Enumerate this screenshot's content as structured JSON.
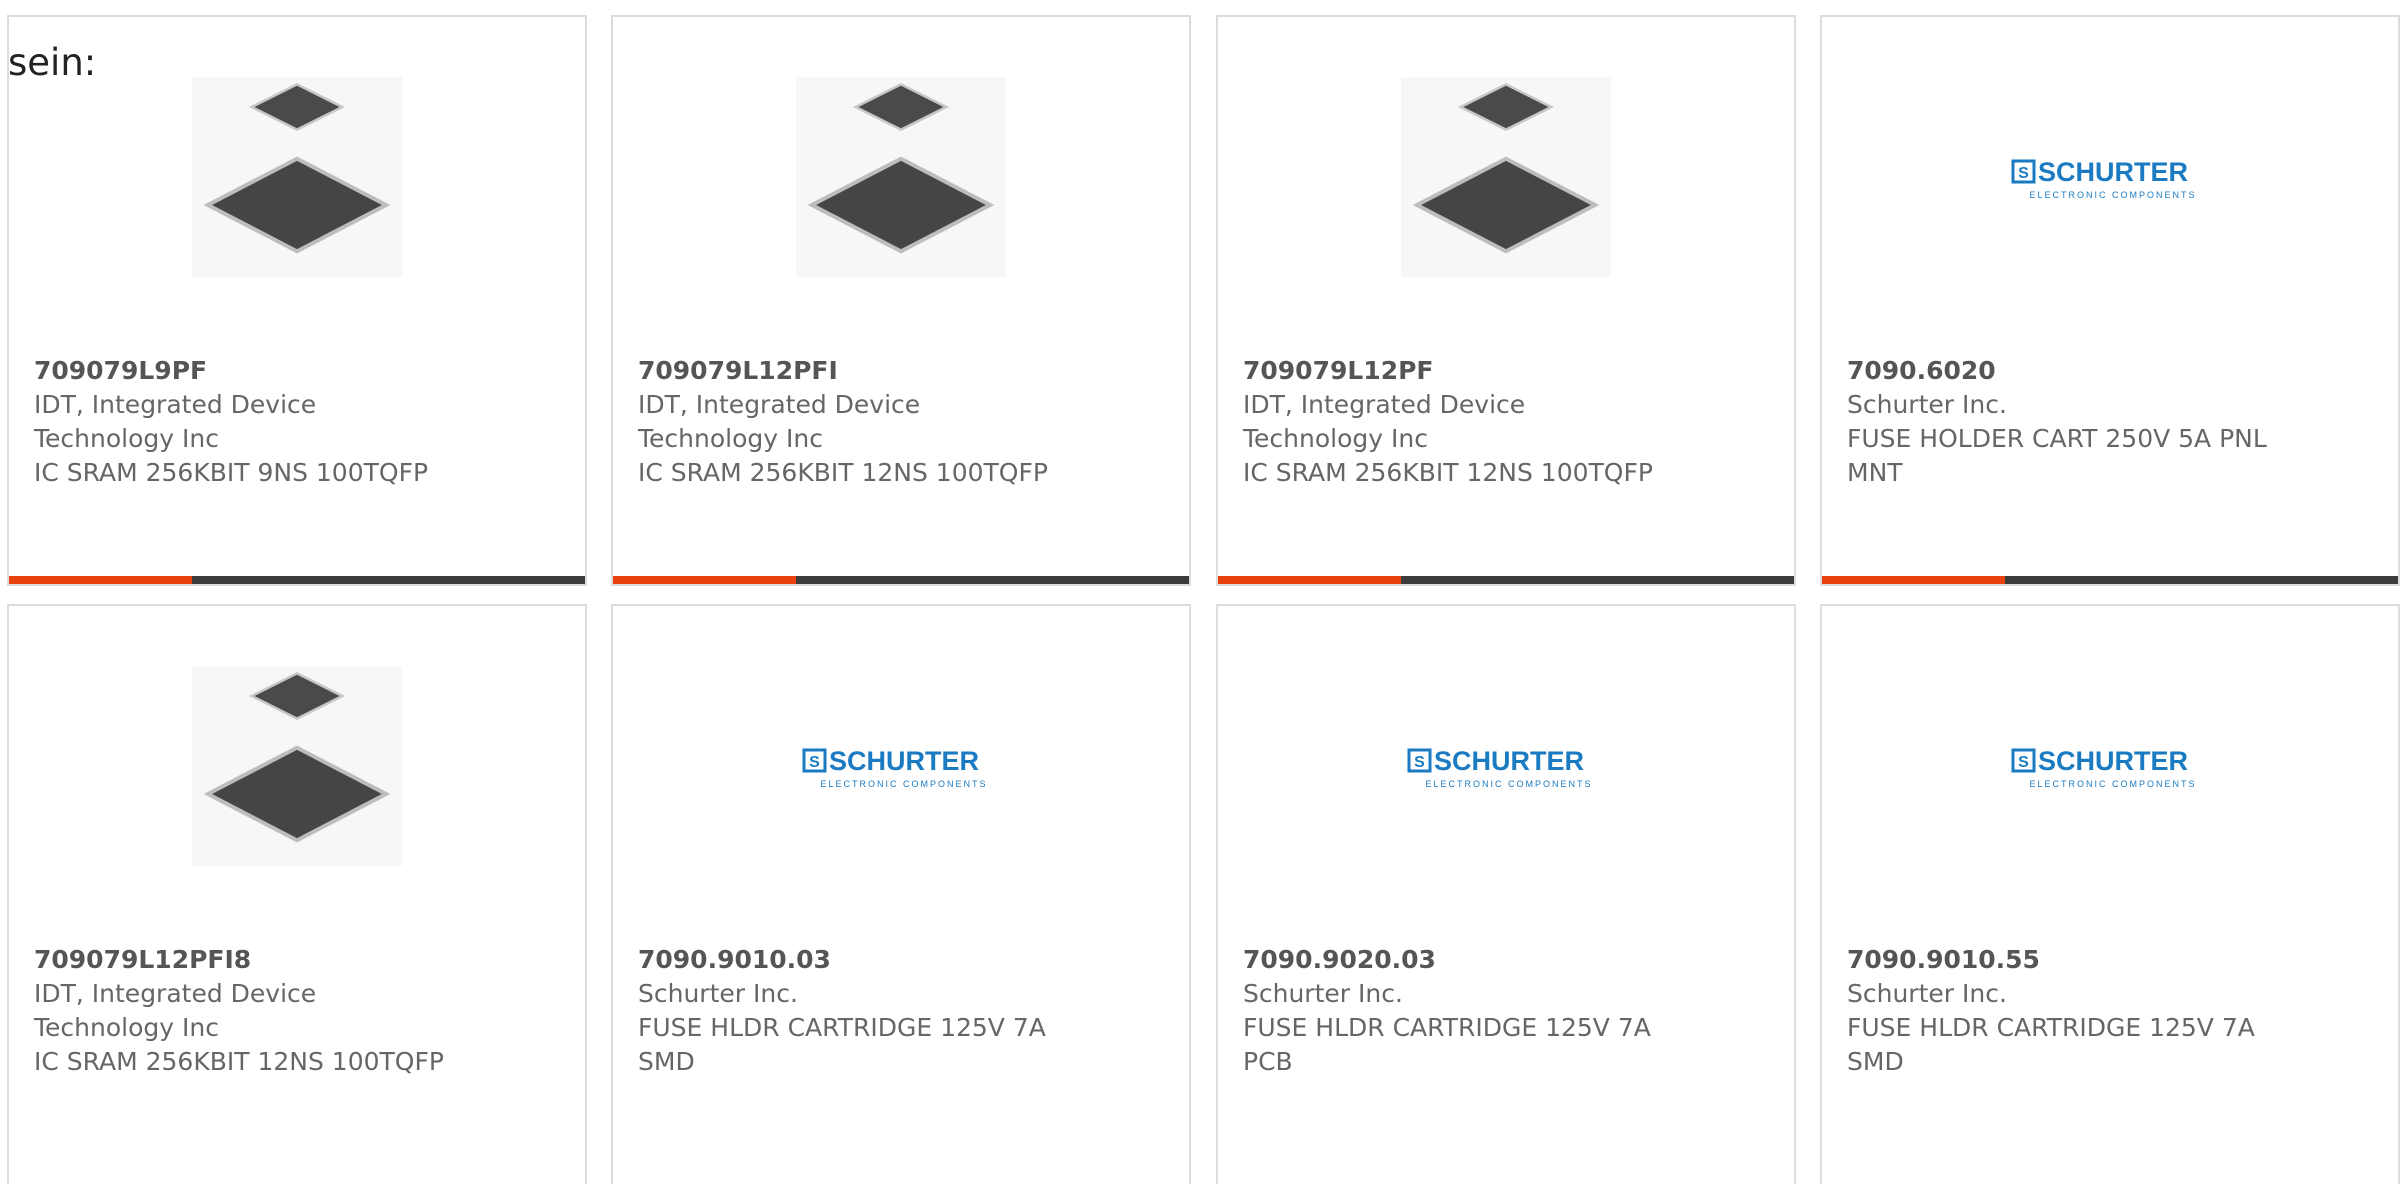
{
  "intro_text": "sein:",
  "colors": {
    "accent": "#e8410f",
    "bar": "#3c3c3c",
    "schurter_blue": "#1a7bc2"
  },
  "products": [
    {
      "part_number": "709079L9PF",
      "manufacturer_line1": "IDT, Integrated Device",
      "manufacturer_line2": "Technology Inc",
      "description_line1": "IC SRAM 256KBIT 9NS 100TQFP",
      "description_line2": "",
      "image": "ic-chip-image"
    },
    {
      "part_number": "709079L12PFI",
      "manufacturer_line1": "IDT, Integrated Device",
      "manufacturer_line2": "Technology Inc",
      "description_line1": "IC SRAM 256KBIT 12NS 100TQFP",
      "description_line2": "",
      "image": "ic-chip-image"
    },
    {
      "part_number": "709079L12PF",
      "manufacturer_line1": "IDT, Integrated Device",
      "manufacturer_line2": "Technology Inc",
      "description_line1": "IC SRAM 256KBIT 12NS 100TQFP",
      "description_line2": "",
      "image": "ic-chip-image"
    },
    {
      "part_number": "7090.6020",
      "manufacturer_line1": "Schurter Inc.",
      "manufacturer_line2": "",
      "description_line1": "FUSE HOLDER CART 250V 5A PNL",
      "description_line2": "MNT",
      "image": "schurter-logo"
    },
    {
      "part_number": "709079L12PFI8",
      "manufacturer_line1": "IDT, Integrated Device",
      "manufacturer_line2": "Technology Inc",
      "description_line1": "IC SRAM 256KBIT 12NS 100TQFP",
      "description_line2": "",
      "image": "ic-chip-image"
    },
    {
      "part_number": "7090.9010.03",
      "manufacturer_line1": "Schurter Inc.",
      "manufacturer_line2": "",
      "description_line1": "FUSE HLDR CARTRIDGE 125V 7A",
      "description_line2": "SMD",
      "image": "schurter-logo"
    },
    {
      "part_number": "7090.9020.03",
      "manufacturer_line1": "Schurter Inc.",
      "manufacturer_line2": "",
      "description_line1": "FUSE HLDR CARTRIDGE 125V 7A",
      "description_line2": "PCB",
      "image": "schurter-logo"
    },
    {
      "part_number": "7090.9010.55",
      "manufacturer_line1": "Schurter Inc.",
      "manufacturer_line2": "",
      "description_line1": "FUSE HLDR CARTRIDGE 125V 7A",
      "description_line2": "SMD",
      "image": "schurter-logo"
    }
  ],
  "schurter_logo": {
    "wordmark": "SCHURTER",
    "tagline": "ELECTRONIC COMPONENTS",
    "badge_letter": "S"
  }
}
